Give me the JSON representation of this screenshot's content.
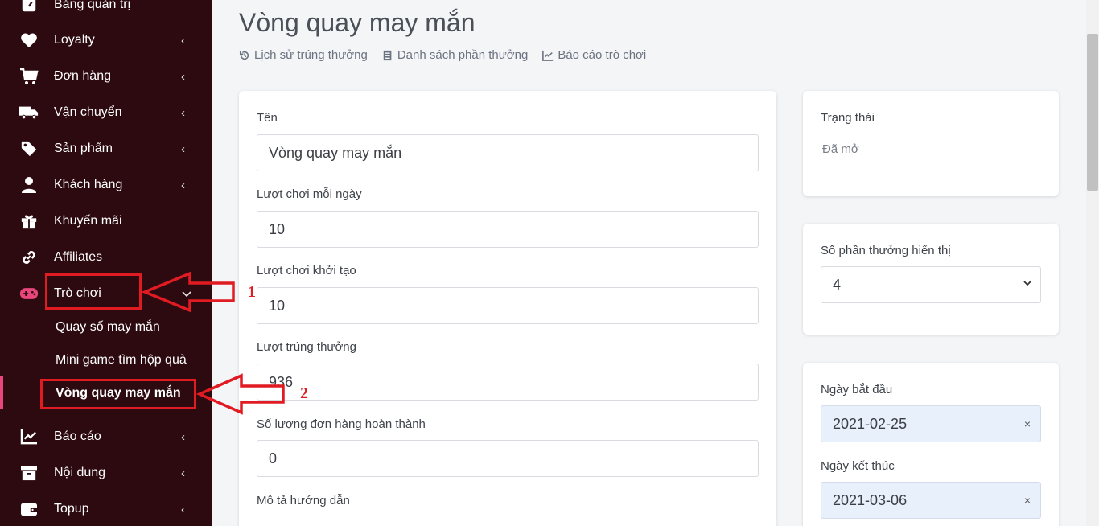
{
  "sidebar": {
    "items": [
      {
        "label": "Bảng quản trị",
        "icon": "dashboard-icon"
      },
      {
        "label": "Loyalty",
        "icon": "heart-icon"
      },
      {
        "label": "Đơn hàng",
        "icon": "cart-icon"
      },
      {
        "label": "Vận chuyển",
        "icon": "truck-icon"
      },
      {
        "label": "Sản phẩm",
        "icon": "tag-icon"
      },
      {
        "label": "Khách hàng",
        "icon": "user-icon"
      },
      {
        "label": "Khuyến mãi",
        "icon": "gift-icon"
      },
      {
        "label": "Affiliates",
        "icon": "link-icon"
      },
      {
        "label": "Trò chơi",
        "icon": "gamepad-icon"
      },
      {
        "label": "Báo cáo",
        "icon": "chart-line-icon"
      },
      {
        "label": "Nội dung",
        "icon": "archive-icon"
      },
      {
        "label": "Topup",
        "icon": "wallet-icon"
      }
    ],
    "submenu": [
      {
        "label": "Quay số may mắn"
      },
      {
        "label": "Mini game tìm hộp quà"
      },
      {
        "label": "Vòng quay may mắn"
      }
    ],
    "chevron_closed": "‹",
    "chevron_open": "⌄"
  },
  "page": {
    "title": "Vòng quay may mắn",
    "links": [
      {
        "label": "Lịch sử trúng thưởng",
        "icon": "history-icon"
      },
      {
        "label": "Danh sách phần thưởng",
        "icon": "list-icon"
      },
      {
        "label": "Báo cáo trò chơi",
        "icon": "chart-icon"
      }
    ]
  },
  "form": {
    "name_label": "Tên",
    "name_value": "Vòng quay may mắn",
    "daily_plays_label": "Lượt chơi mỗi ngày",
    "daily_plays_value": "10",
    "initial_plays_label": "Lượt chơi khởi tạo",
    "initial_plays_value": "10",
    "winning_plays_label": "Lượt trúng thưởng",
    "winning_plays_value": "936",
    "completed_orders_label": "Số lượng đơn hàng hoàn thành",
    "completed_orders_value": "0",
    "description_label": "Mô tả hướng dẫn"
  },
  "status": {
    "label": "Trạng thái",
    "value": "Đã mở"
  },
  "prizes_display": {
    "label": "Số phần thưởng hiển thị",
    "value": "4"
  },
  "dates": {
    "start_label": "Ngày bắt đầu",
    "start_value": "2021-02-25",
    "end_label": "Ngày kết thúc",
    "end_value": "2021-03-06",
    "clear_symbol": "×"
  },
  "annotations": {
    "marker_1": "1",
    "marker_2": "2"
  },
  "colors": {
    "sidebar_bg": "#2c0a10",
    "active_accent": "#e8467c",
    "annotation_red": "#e11b22"
  }
}
